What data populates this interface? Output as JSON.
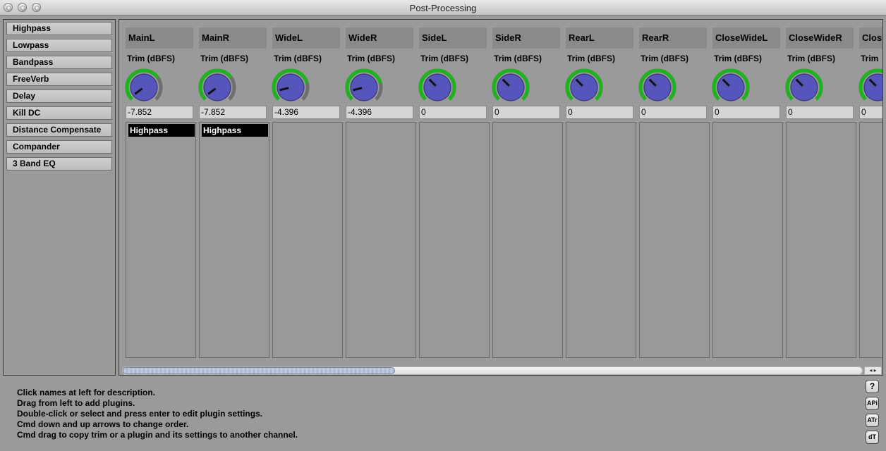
{
  "window": {
    "title": "Post-Processing"
  },
  "plugins": [
    "Highpass",
    "Lowpass",
    "Bandpass",
    "FreeVerb",
    "Delay",
    "Kill DC",
    "Distance Compensate",
    "Compander",
    "3 Band EQ"
  ],
  "colors": {
    "knob_ring_green": "#1fb21f",
    "knob_ring_gray": "#6e6e6e",
    "knob_body": "#5555bb",
    "plugin_slot_bg": "#000000"
  },
  "channels": [
    {
      "name": "MainL",
      "trim_label": "Trim (dBFS)",
      "value": "-7.852",
      "knob_fraction": 0.7,
      "plugins": [
        "Highpass"
      ]
    },
    {
      "name": "MainR",
      "trim_label": "Trim (dBFS)",
      "value": "-7.852",
      "knob_fraction": 0.7,
      "plugins": [
        "Highpass"
      ]
    },
    {
      "name": "WideL",
      "trim_label": "Trim (dBFS)",
      "value": "-4.396",
      "knob_fraction": 0.78,
      "plugins": []
    },
    {
      "name": "WideR",
      "trim_label": "Trim (dBFS)",
      "value": "-4.396",
      "knob_fraction": 0.78,
      "plugins": []
    },
    {
      "name": "SideL",
      "trim_label": "Trim (dBFS)",
      "value": "0",
      "knob_fraction": 1.0,
      "plugins": []
    },
    {
      "name": "SideR",
      "trim_label": "Trim (dBFS)",
      "value": "0",
      "knob_fraction": 1.0,
      "plugins": []
    },
    {
      "name": "RearL",
      "trim_label": "Trim (dBFS)",
      "value": "0",
      "knob_fraction": 1.0,
      "plugins": []
    },
    {
      "name": "RearR",
      "trim_label": "Trim (dBFS)",
      "value": "0",
      "knob_fraction": 1.0,
      "plugins": []
    },
    {
      "name": "CloseWideL",
      "trim_label": "Trim (dBFS)",
      "value": "0",
      "knob_fraction": 1.0,
      "plugins": []
    },
    {
      "name": "CloseWideR",
      "trim_label": "Trim (dBFS)",
      "value": "0",
      "knob_fraction": 1.0,
      "plugins": []
    },
    {
      "name": "Clos",
      "trim_label": "Trim",
      "value": "0",
      "knob_fraction": 1.0,
      "plugins": []
    }
  ],
  "help": [
    "Click names at left for description.",
    "Drag from left to add plugins.",
    "Double-click or select and press enter to edit plugin settings.",
    "Cmd down and up arrows to change order.",
    "Cmd drag to copy trim or a plugin and its settings to another channel."
  ],
  "side_buttons": [
    {
      "name": "help-button",
      "label": "?"
    },
    {
      "name": "api-button",
      "label": "APi"
    },
    {
      "name": "atr-button",
      "label": "ATr"
    },
    {
      "name": "dt-button",
      "label": "dT"
    }
  ],
  "scroll_arrows": "◂ ▸"
}
